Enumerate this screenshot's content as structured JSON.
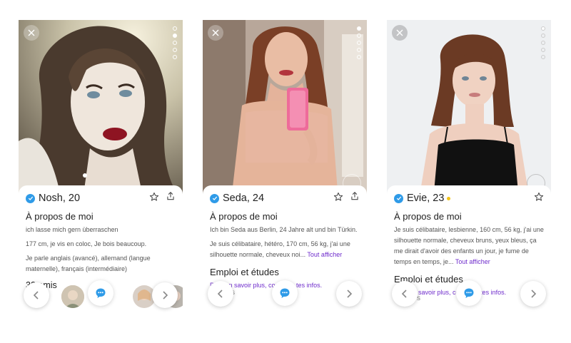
{
  "profiles": [
    {
      "name_age": "Nosh, 20",
      "about_title": "À propos de moi",
      "about_lines": [
        "ich lasse mich gern überraschen",
        "177 cm, je vis en coloc, Je bois beaucoup.",
        "Je parle anglais (avancé), allemand (langue maternelle), français (intermédiaire)"
      ],
      "friends": "32 amis",
      "photo_index": "2 of 5"
    },
    {
      "name_age": "Seda, 24",
      "about_title": "À propos de moi",
      "about_lines": [
        "Ich bin Seda aus Berlin, 24 Jahre alt und bin Türkin.",
        "Je suis célibataire, hétéro, 170 cm, 56 kg, j'ai une silhouette normale, cheveux noi..."
      ],
      "more_label": "Tout afficher",
      "work_title": "Emploi et études",
      "work_link": "Pour en savoir plus, complète tes infos.",
      "fragment": "s",
      "photo_index": "1 of 5"
    },
    {
      "name_age": "Evie, 23",
      "online_color": "#f2c318",
      "about_title": "À propos de moi",
      "about_lines": [
        "Je suis célibataire, lesbienne, 160 cm, 56 kg, j'ai une silhouette normale, cheveux bruns, yeux bleus, ça me dirait d'avoir des enfants un jour, je fume de temps en temps, je..."
      ],
      "more_label": "Tout afficher",
      "work_title": "Emploi et études",
      "work_link": "Pour en savoir plus, complète tes infos.",
      "fragment": "s",
      "photo_index": "1 of 5"
    }
  ],
  "icons": {
    "close": "close-icon",
    "verified": "verified-check-icon",
    "star": "star-icon",
    "share": "share-icon",
    "chat": "chat-bubble-icon",
    "prev": "chevron-left-icon",
    "next": "chevron-right-icon"
  },
  "colors": {
    "verified": "#2f9be8",
    "link": "#6f2ccc",
    "online": "#f2c318"
  }
}
